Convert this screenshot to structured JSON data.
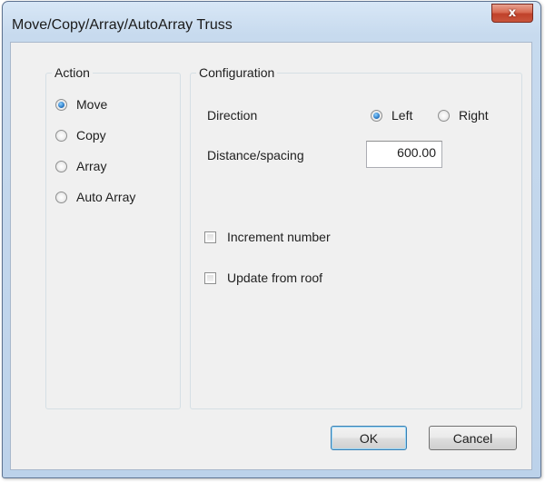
{
  "window": {
    "title": "Move/Copy/Array/AutoArray Truss",
    "close_glyph": "x"
  },
  "action": {
    "legend": "Action",
    "options": [
      {
        "label": "Move",
        "checked": true
      },
      {
        "label": "Copy",
        "checked": false
      },
      {
        "label": "Array",
        "checked": false
      },
      {
        "label": "Auto Array",
        "checked": false
      }
    ]
  },
  "configuration": {
    "legend": "Configuration",
    "direction_label": "Direction",
    "direction_options": [
      {
        "label": "Left",
        "checked": true
      },
      {
        "label": "Right",
        "checked": false
      }
    ],
    "distance_label": "Distance/spacing",
    "distance_value": "600.00",
    "checkboxes": [
      {
        "label": "Increment number",
        "checked": false
      },
      {
        "label": "Update from roof",
        "checked": false
      }
    ]
  },
  "buttons": {
    "ok": "OK",
    "cancel": "Cancel"
  },
  "colors": {
    "accent_radio": "#2c7bc7",
    "close_button": "#c9553c",
    "frame": "#bcd2ea"
  }
}
